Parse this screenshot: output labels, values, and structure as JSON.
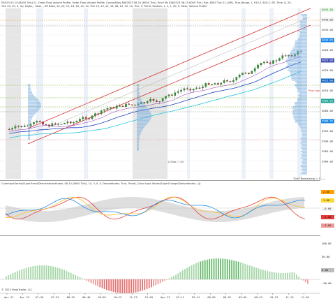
{
  "header": {
    "line1": "ESH23 03-15 [6000 Tick] 21, Order Flow Volume Profile, Order Flow Volume Profile, ConvertDay 8/6/2023 08-15 [6000 Tick], Price Ms (08/2023 08-15 6000 Tick), Bar, 6000 Tick 21, [NR), True_Range, 1, 610,2, 610,2, SR, Time, 8, 20...",
    "line2": "Tick 20, 20, 3, Up, Highs, , False, , SR Base, 10, 20, 10, 16, 20, 10, 10, Tick 10, 10, 14, 16, 08, 10, 10, 10, Tick, 5, Trend, Session, 1, 2, 1, 20, 0, False, Volume Profile"
  },
  "price_axis": {
    "ticks": [
      {
        "label": "4044.40",
        "color": "#e8f5e9",
        "fg": "#1b8a1b"
      },
      {
        "label": "4040.00",
        "color": "#f2f2f2",
        "fg": "#333333"
      },
      {
        "label": "4035.00",
        "color": "#ffffff",
        "fg": "#333333"
      },
      {
        "label": "4030.05",
        "color": "#1e88e5",
        "fg": "#ffffff"
      },
      {
        "label": "4028.00",
        "color": "#ffffff",
        "fg": "#333333"
      },
      {
        "label": "4025.00",
        "color": "#3f51b5",
        "fg": "#ffffff"
      },
      {
        "label": "4020.00",
        "color": "#ffffff",
        "fg": "#333333"
      },
      {
        "label": "4015.00",
        "color": "#1565c0",
        "fg": "#ffffff"
      },
      {
        "label": "4010.00",
        "color": "#ffffff",
        "fg": "#333333"
      },
      {
        "label": "4006.25",
        "color": "#26a69a",
        "fg": "#ffffff"
      },
      {
        "label": "4000.00",
        "color": "#ffffff",
        "fg": "#333333"
      },
      {
        "label": "3998.75",
        "color": "#1e88e5",
        "fg": "#ffffff"
      },
      {
        "label": "3995.00",
        "color": "#ffffff",
        "fg": "#333333"
      },
      {
        "label": "3990.00",
        "color": "#ffffff",
        "fg": "#333333"
      },
      {
        "label": "3985.00",
        "color": "#ffffff",
        "fg": "#333333"
      },
      {
        "label": "3980.00",
        "color": "#ffffff",
        "fg": "#333333"
      }
    ]
  },
  "annotations": {
    "ticks_remaining": "Ticks Remaining = 5914",
    "prior_low": "Prior Low",
    "value_low": "1.00da / 1.00"
  },
  "indicator1": {
    "header": "ColorInputSeries(SuperTrend(DeriveIndirectIndex, 08-15 [6000 Tick], 14, 3, 0, 0, DerivedIndex, True, Trend), Color Input Series(SuperChange(DerivedIndex...)))",
    "levels": [
      {
        "label": "2.00",
        "color": "#ffa000"
      },
      {
        "label": "1.00",
        "color": "#fdd835"
      },
      {
        "label": "-0.00",
        "color": "#f5f5f5"
      },
      {
        "label": "-1.00",
        "color": "#e53935"
      },
      {
        "label": "-2.00",
        "color": "#ef9a9a"
      }
    ]
  },
  "indicator2": {
    "header": "LS_Zerlag_Oscillator",
    "levels": [
      {
        "label": "100.00",
        "color": "#ffffff"
      },
      {
        "label": "50.00",
        "color": "#ffffff"
      },
      {
        "label": "0.00",
        "color": "#bdbdbd"
      },
      {
        "label": "-50.00",
        "color": "#ffffff"
      }
    ]
  },
  "copyright": "© 2023 NinjaTrader, LLC",
  "time_axis": {
    "labels": [
      "Apr 21",
      "Apr 23",
      "07:36",
      "07:52",
      "08:25",
      "08:46",
      "09:05",
      "10:23",
      "11:23",
      "13:03",
      "Apr 23",
      "07:11",
      "07:41",
      "08:09",
      "08:32",
      "09:09",
      "09:43",
      "10:13",
      "11:13",
      "12:02"
    ]
  },
  "colors": {
    "up_candle": "#2e9e2e",
    "down_candle": "#d32f2f",
    "channel_red": "#d32f2f",
    "ma_blue": "#1e3fbf",
    "ma_cyan": "#26c6da",
    "volume_profile": "#6fa8dc",
    "session_shade": "#d9d9d9"
  }
}
